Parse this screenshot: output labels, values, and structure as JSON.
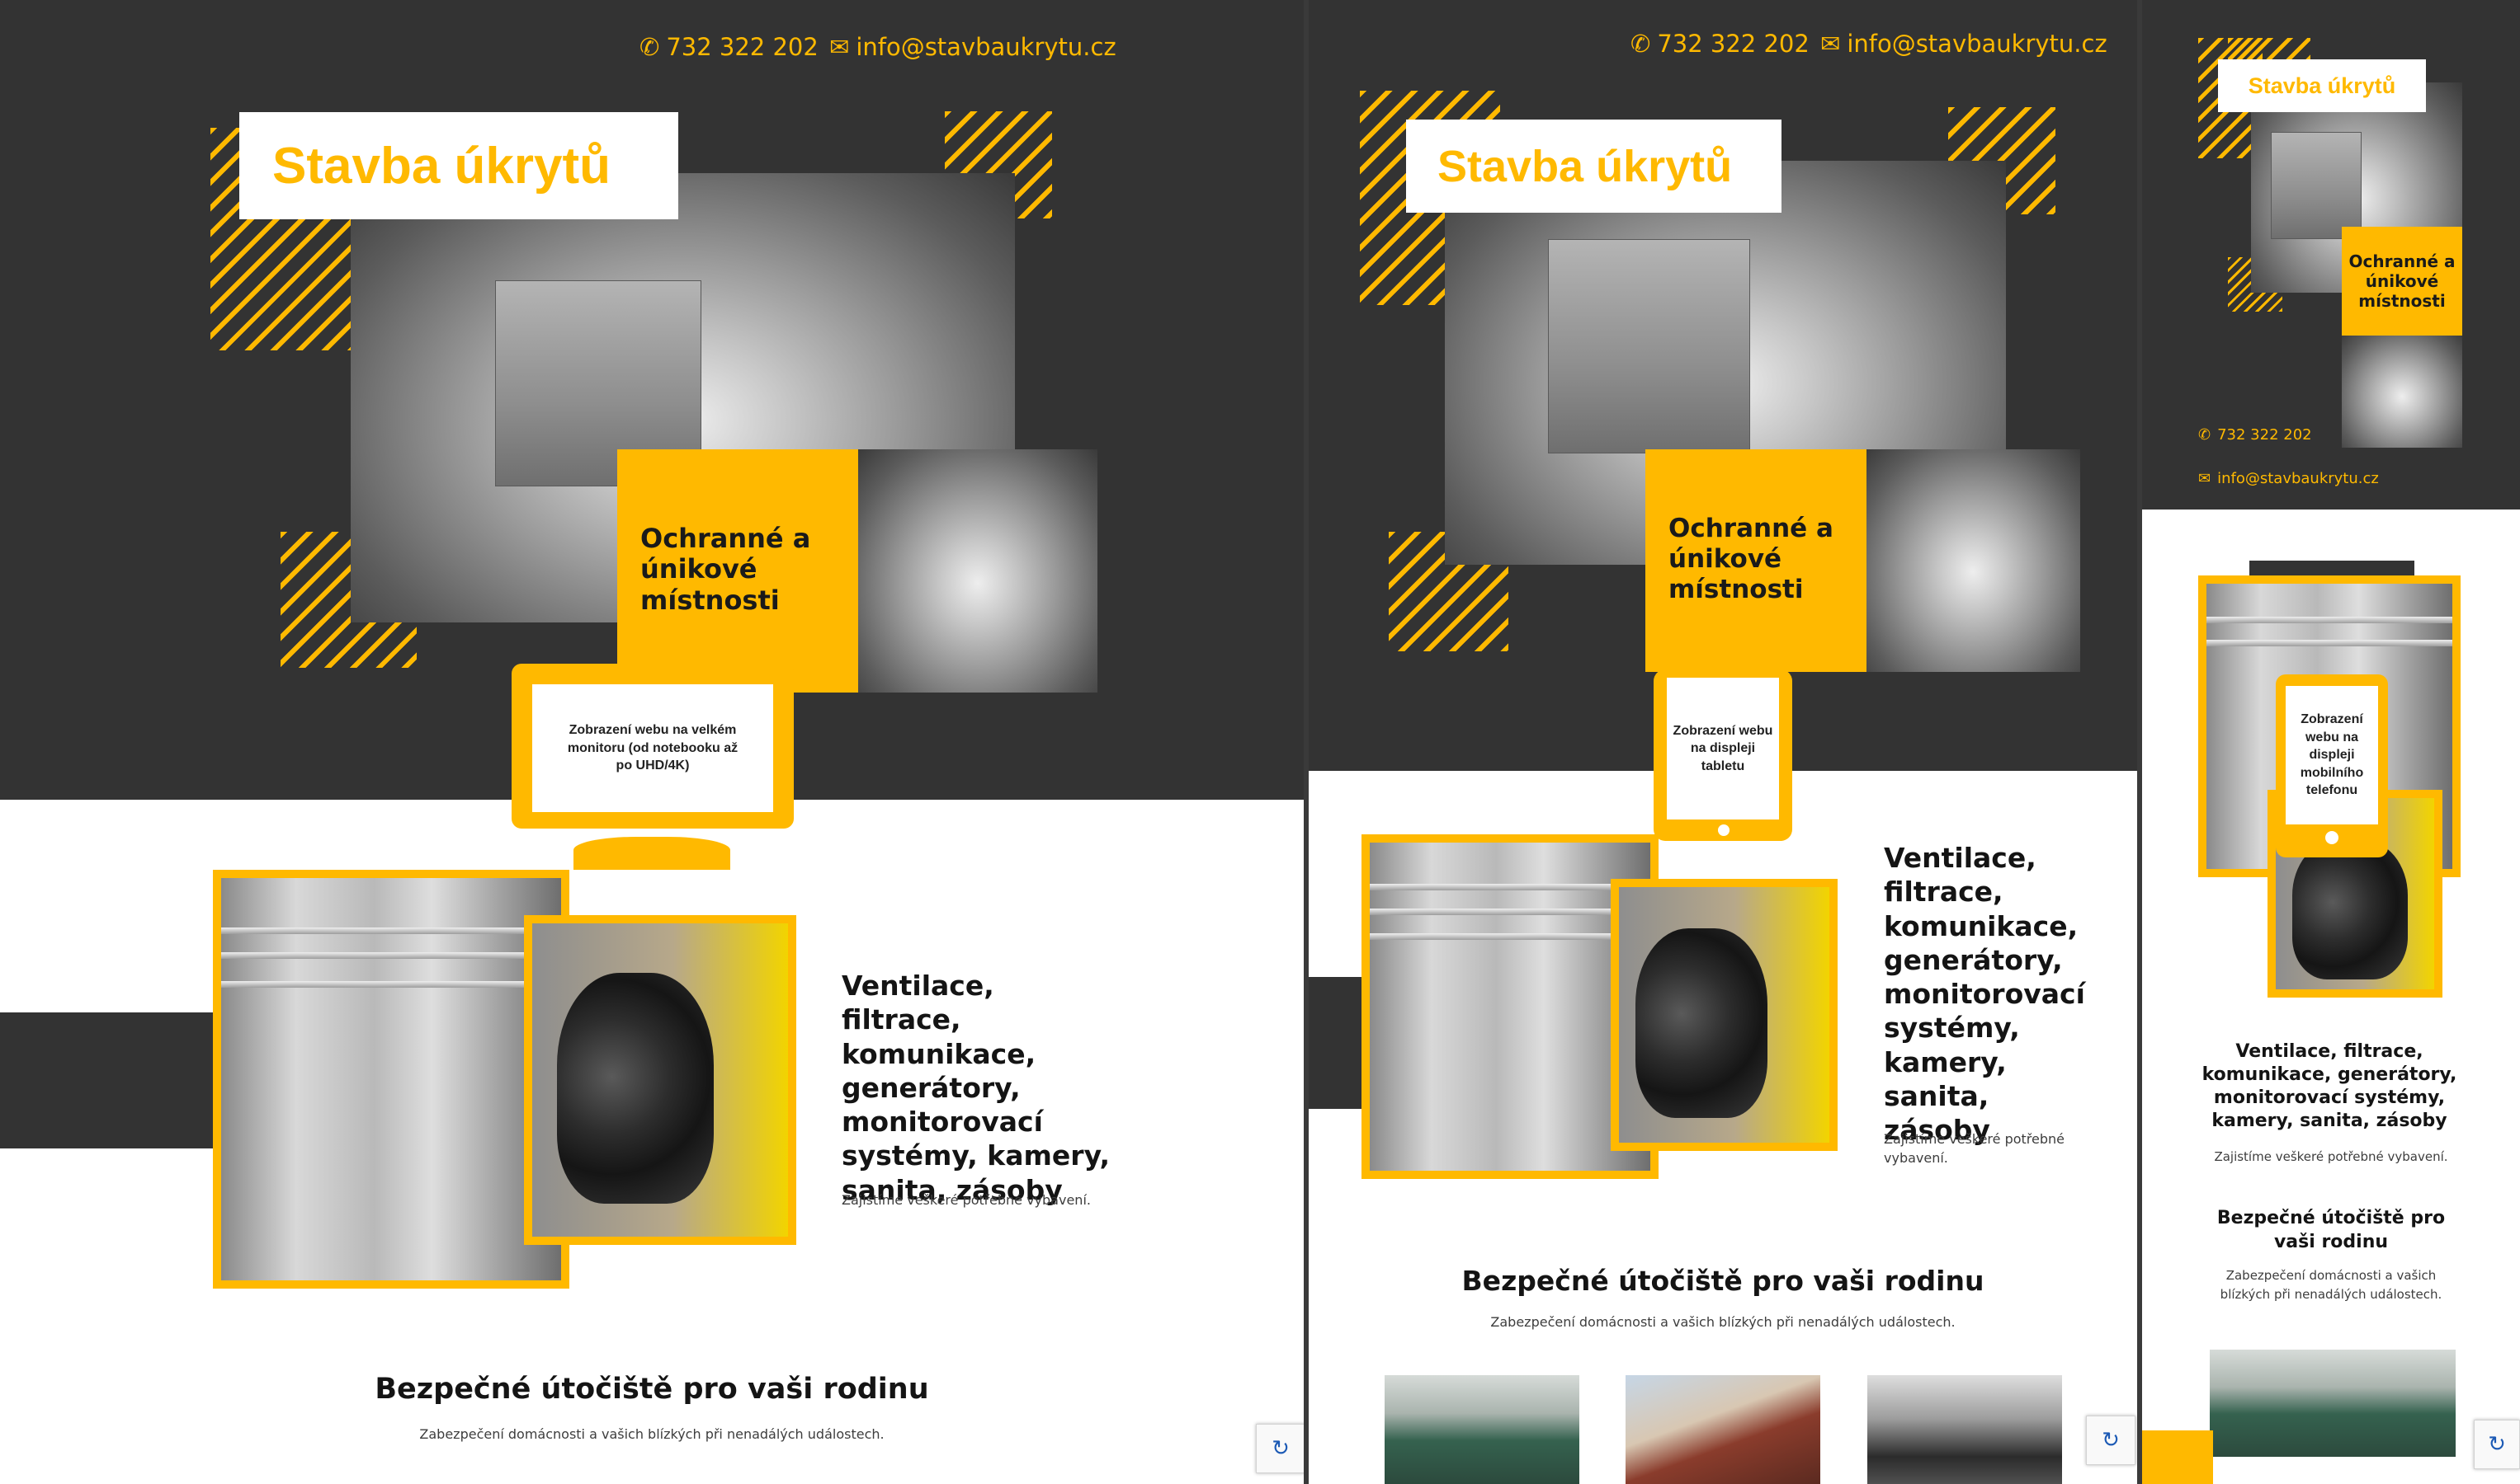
{
  "site": {
    "brand": "Stavba úkrytů",
    "phone": "732 322 202",
    "email": "info@stavbaukrytu.cz",
    "hero_badge": "Ochranné a únikové místnosti",
    "feature_title": "Ventilace, filtrace, komunikace, generátory, monitorovací systémy, kamery, sanita, zásoby",
    "feature_text": "Zajistíme veškeré potřebné vybavení.",
    "section_title": "Bezpečné útočiště pro vaši rodinu",
    "section_text": "Zabezpečení domácnosti a vašich blízkých při nenadálých událostech."
  },
  "devices": {
    "desktop": "Zobrazení webu na velkém monitoru (od notebooku až po UHD/4K)",
    "tablet": "Zobrazení webu na displeji tabletu",
    "mobile": "Zobrazení webu na displeji mobilního telefonu"
  },
  "icons": {
    "phone": "phone-icon",
    "email": "mail-icon",
    "recaptcha": "recaptcha-icon"
  },
  "colors": {
    "accent": "#ffb900",
    "dark": "#333333",
    "text": "#141414"
  }
}
